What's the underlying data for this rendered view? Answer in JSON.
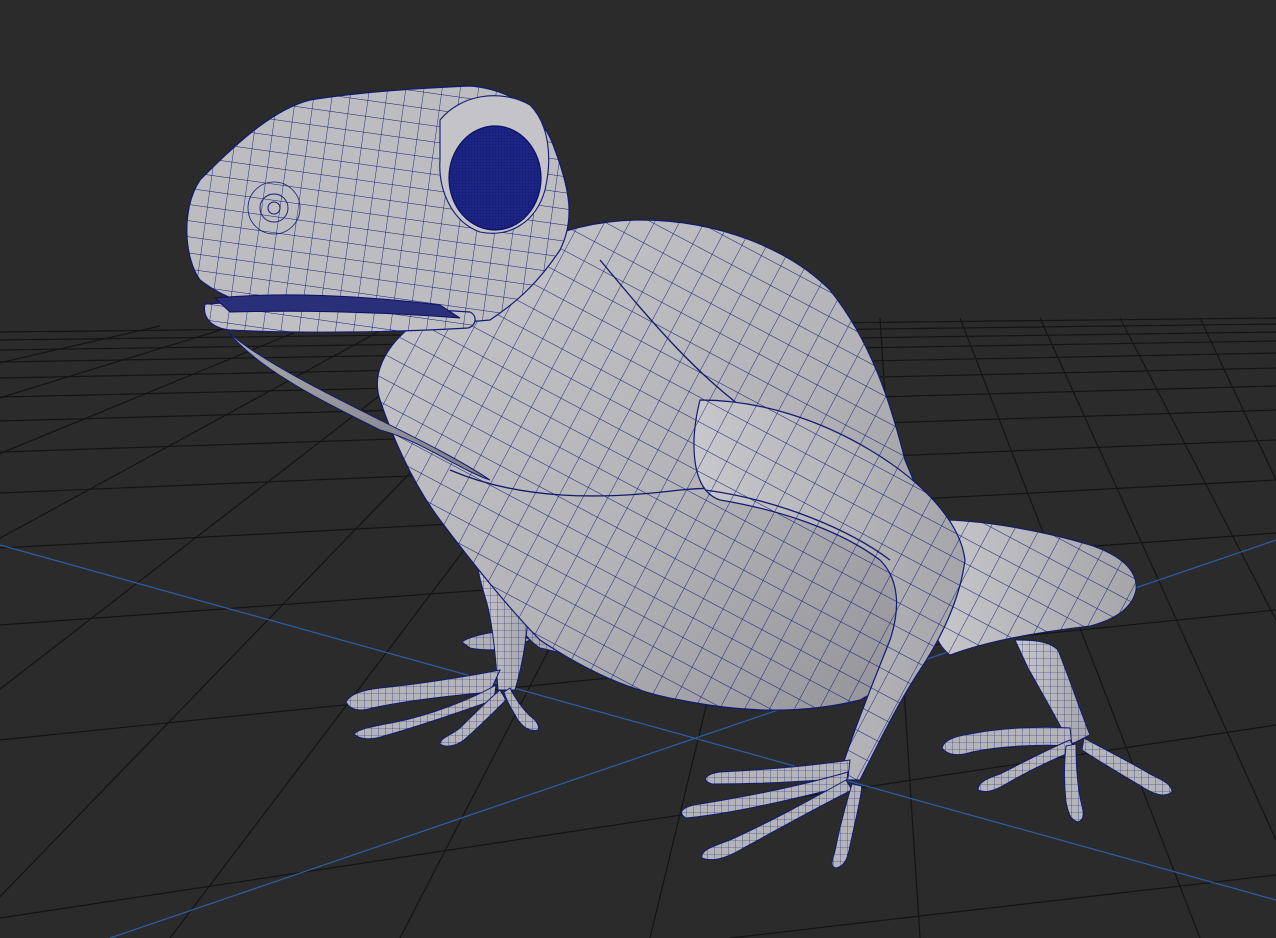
{
  "viewport": {
    "background": "#2b2b2b",
    "grid_color": "#111111",
    "axis_color": "#2b5fa8"
  },
  "model": {
    "surface_color": "#b9b9bd",
    "shadow_color": "#8f8f94",
    "wireframe_color": "#101a73",
    "eye_color": "#1d2686"
  }
}
